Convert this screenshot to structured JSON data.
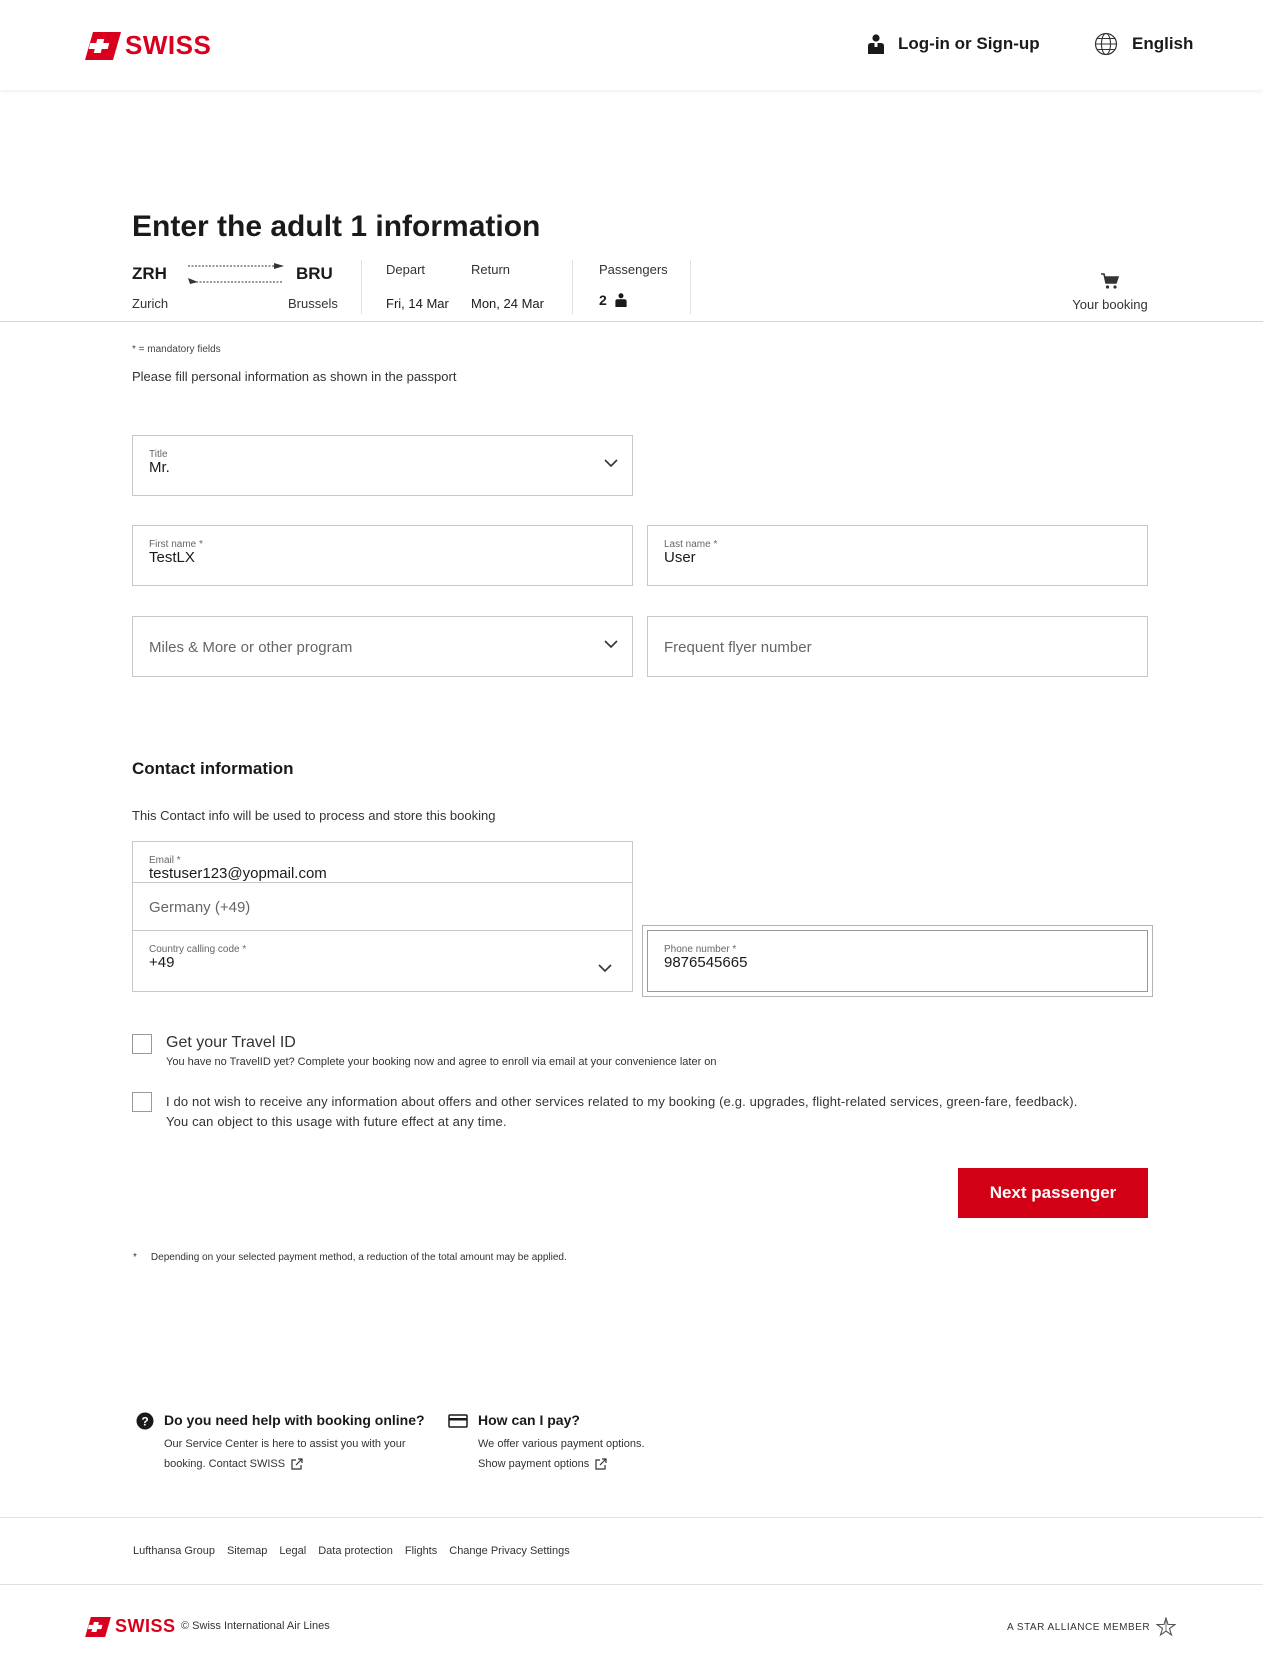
{
  "brand": {
    "name": "SWISS",
    "color": "#d8001d"
  },
  "header": {
    "login_label": "Log-in or Sign-up",
    "language_label": "English"
  },
  "page": {
    "title": "Enter the adult 1 information"
  },
  "booking_summary": {
    "origin_code": "ZRH",
    "origin_city": "Zurich",
    "destination_code": "BRU",
    "destination_city": "Brussels",
    "depart_label": "Depart",
    "depart_date": "Fri, 14 Mar",
    "return_label": "Return",
    "return_date": "Mon, 24 Mar",
    "passengers_label": "Passengers",
    "passengers_count": "2",
    "your_booking_label": "Your booking"
  },
  "notes": {
    "mandatory": "* = mandatory fields",
    "passport": "Please fill personal information as shown in the passport"
  },
  "personal": {
    "title_label": "Title",
    "title_value": "Mr.",
    "first_name_label": "First name *",
    "first_name_value": "TestLX",
    "last_name_label": "Last name *",
    "last_name_value": "User",
    "program_placeholder": "Miles & More or other program",
    "ff_number_placeholder": "Frequent flyer number"
  },
  "contact": {
    "heading": "Contact information",
    "subheading": "This Contact info will be used to process and store this booking",
    "email_label": "Email *",
    "email_value": "testuser123@yopmail.com",
    "country_suggestion": "Germany (+49)",
    "calling_code_label": "Country calling code *",
    "calling_code_value": "+49",
    "phone_label": "Phone number *",
    "phone_value": "9876545665"
  },
  "consents": {
    "travel_id_title": "Get your Travel ID",
    "travel_id_sub": "You have no TravelID yet? Complete your booking now and agree to enroll via email at your convenience later on",
    "opt_out_line1": "I do not wish to receive any information about offers and other services related to my booking (e.g. upgrades, flight-related services, green-fare, feedback).",
    "opt_out_line2": "You can object to this usage with future effect at any time."
  },
  "actions": {
    "next_label": "Next passenger"
  },
  "footnote": {
    "marker": "*",
    "text": "Depending on your selected payment method, a reduction of the total amount may be applied."
  },
  "help": {
    "booking_title": "Do you need help with booking online?",
    "booking_text": "Our Service Center is here to assist you with your",
    "booking_link": "booking. Contact SWISS",
    "pay_title": "How can I pay?",
    "pay_text": "We offer various payment options.",
    "pay_link": "Show payment options"
  },
  "footer": {
    "links": [
      "Lufthansa Group",
      "Sitemap",
      "Legal",
      "Data protection",
      "Flights",
      "Change Privacy Settings"
    ],
    "copyright": "© Swiss International Air Lines",
    "star_alliance": "A STAR ALLIANCE MEMBER"
  }
}
